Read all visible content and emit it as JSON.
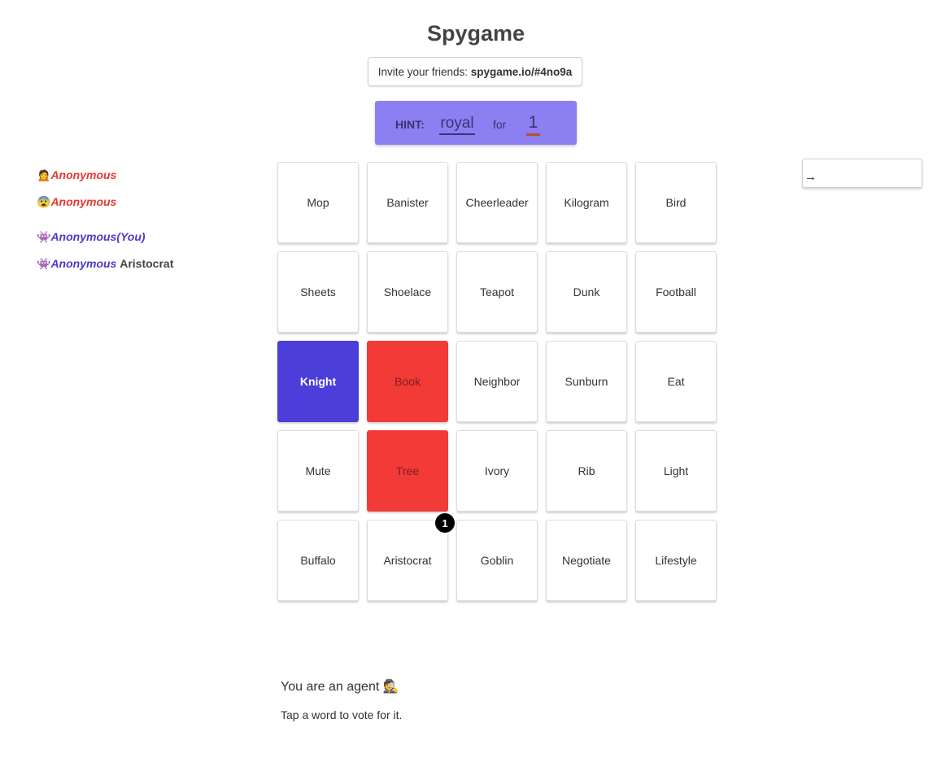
{
  "title": "Spygame",
  "invite": {
    "prefix": "Invite your friends: ",
    "link": "spygame.io/#4no9a"
  },
  "hint": {
    "label": "HINT:",
    "word": "royal",
    "for": "for",
    "count": "1"
  },
  "players": [
    {
      "emoji": "🙍",
      "name": "Anonymous",
      "team": "red",
      "suffix": "",
      "vote": ""
    },
    {
      "emoji": "😨",
      "name": "Anonymous",
      "team": "red",
      "suffix": "",
      "vote": ""
    },
    {
      "emoji": "👾",
      "name": "Anonymous",
      "team": "blue",
      "suffix": "(You)",
      "vote": ""
    },
    {
      "emoji": "👾",
      "name": "Anonymous",
      "team": "blue",
      "suffix": "",
      "vote": "Aristocrat"
    }
  ],
  "cards": [
    {
      "word": "Mop",
      "state": "unrevealed"
    },
    {
      "word": "Banister",
      "state": "unrevealed"
    },
    {
      "word": "Cheerleader",
      "state": "unrevealed"
    },
    {
      "word": "Kilogram",
      "state": "unrevealed"
    },
    {
      "word": "Bird",
      "state": "unrevealed"
    },
    {
      "word": "Sheets",
      "state": "unrevealed"
    },
    {
      "word": "Shoelace",
      "state": "unrevealed"
    },
    {
      "word": "Teapot",
      "state": "unrevealed"
    },
    {
      "word": "Dunk",
      "state": "unrevealed"
    },
    {
      "word": "Football",
      "state": "unrevealed"
    },
    {
      "word": "Knight",
      "state": "blue"
    },
    {
      "word": "Book",
      "state": "red"
    },
    {
      "word": "Neighbor",
      "state": "unrevealed"
    },
    {
      "word": "Sunburn",
      "state": "unrevealed"
    },
    {
      "word": "Eat",
      "state": "unrevealed"
    },
    {
      "word": "Mute",
      "state": "unrevealed"
    },
    {
      "word": "Tree",
      "state": "red"
    },
    {
      "word": "Ivory",
      "state": "unrevealed"
    },
    {
      "word": "Rib",
      "state": "unrevealed"
    },
    {
      "word": "Light",
      "state": "unrevealed"
    },
    {
      "word": "Buffalo",
      "state": "unrevealed"
    },
    {
      "word": "Aristocrat",
      "state": "unrevealed",
      "votes": "1"
    },
    {
      "word": "Goblin",
      "state": "unrevealed"
    },
    {
      "word": "Negotiate",
      "state": "unrevealed"
    },
    {
      "word": "Lifestyle",
      "state": "unrevealed"
    }
  ],
  "chat": {
    "arrow": "→"
  },
  "role": "You are an agent 🕵",
  "instructions": "Tap a word to vote for it.",
  "colors": {
    "blue_team": "#4c3fd9",
    "red_team": "#f23a37",
    "hint_bg": "#8c7ff2"
  }
}
